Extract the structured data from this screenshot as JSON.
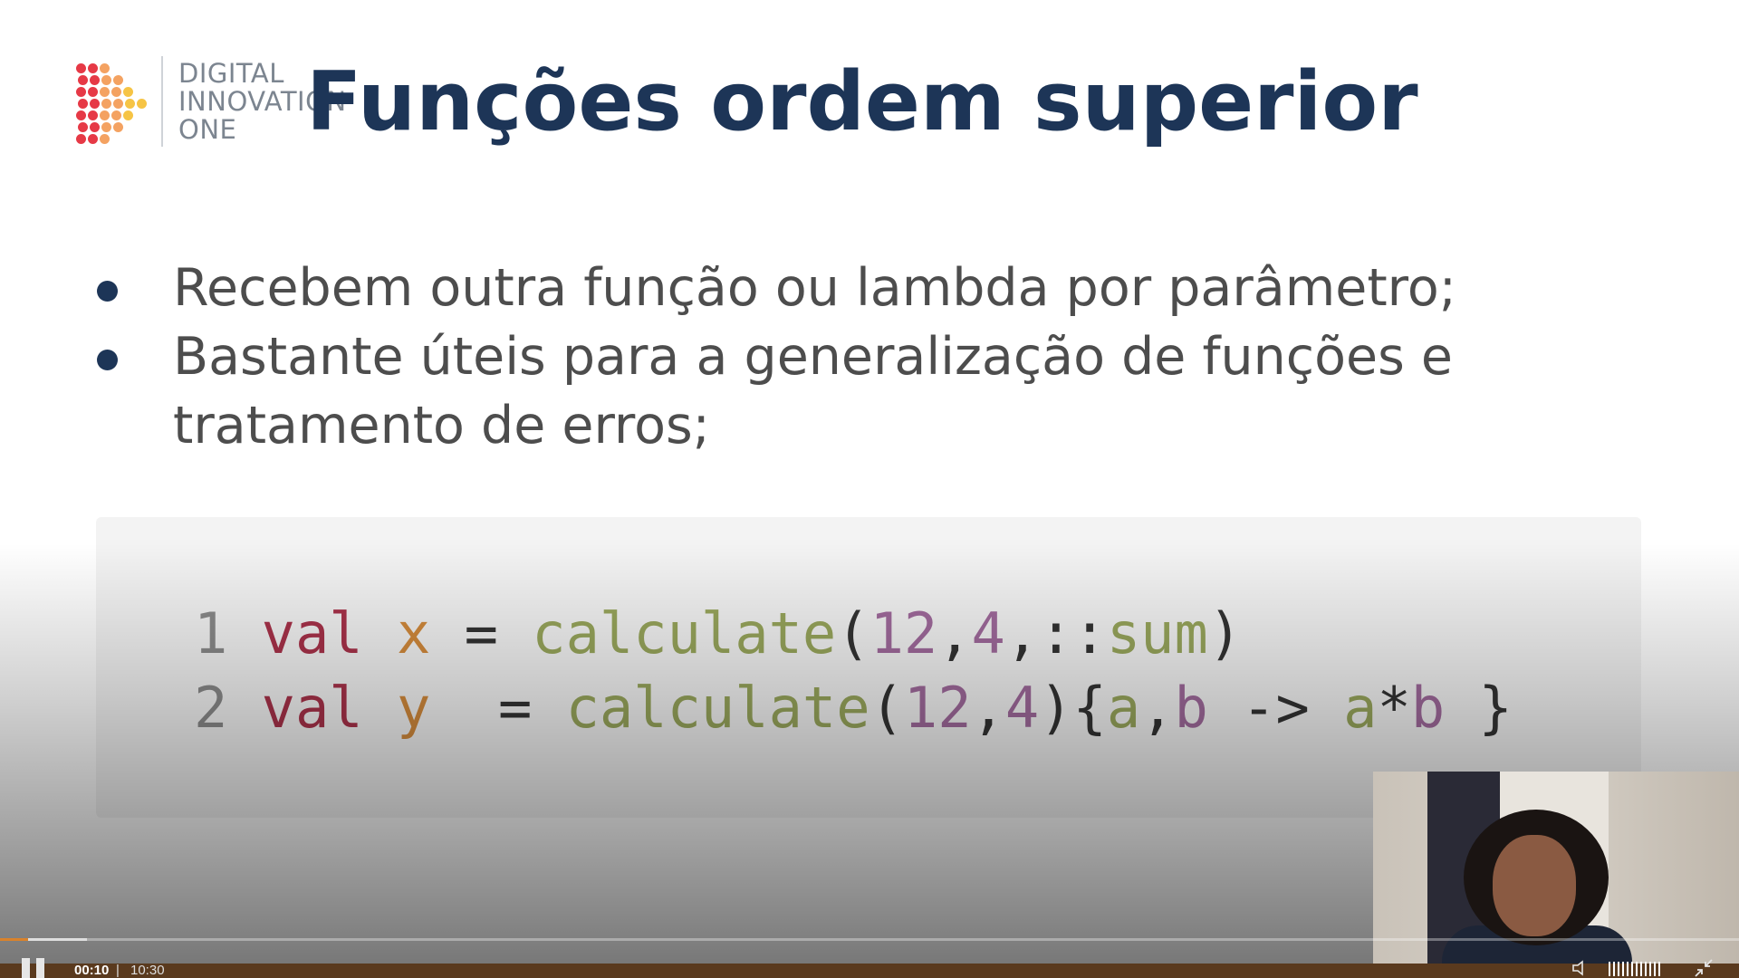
{
  "slide": {
    "logo": {
      "lines": [
        "DIGITAL",
        "INNOVATION",
        "ONE"
      ],
      "icon": "dio-logo-icon",
      "colors": [
        "#e63946",
        "#f4a261",
        "#f6c445"
      ]
    },
    "title": "Funções ordem superior",
    "bullets": [
      "Recebem outra função ou lambda por parâmetro;",
      "Bastante úteis para a generalização de funções e tratamento de erros;"
    ],
    "code": {
      "lines": [
        {
          "number": "1",
          "tokens": [
            {
              "text": "val",
              "type": "kw"
            },
            {
              "text": " ",
              "type": "pun"
            },
            {
              "text": "x",
              "type": "id"
            },
            {
              "text": " = ",
              "type": "pun"
            },
            {
              "text": "calculate",
              "type": "fn"
            },
            {
              "text": "(",
              "type": "pun"
            },
            {
              "text": "12",
              "type": "num"
            },
            {
              "text": ",",
              "type": "pun"
            },
            {
              "text": "4",
              "type": "num"
            },
            {
              "text": ",::",
              "type": "pun"
            },
            {
              "text": "sum",
              "type": "fn"
            },
            {
              "text": ")",
              "type": "pun"
            }
          ]
        },
        {
          "number": "2",
          "tokens": [
            {
              "text": "val",
              "type": "kw"
            },
            {
              "text": " ",
              "type": "pun"
            },
            {
              "text": "y",
              "type": "id"
            },
            {
              "text": "  = ",
              "type": "pun"
            },
            {
              "text": "calculate",
              "type": "fn"
            },
            {
              "text": "(",
              "type": "pun"
            },
            {
              "text": "12",
              "type": "num"
            },
            {
              "text": ",",
              "type": "pun"
            },
            {
              "text": "4",
              "type": "num"
            },
            {
              "text": "){",
              "type": "pun"
            },
            {
              "text": "a",
              "type": "fn"
            },
            {
              "text": ",",
              "type": "pun"
            },
            {
              "text": "b",
              "type": "num"
            },
            {
              "text": " -> ",
              "type": "pun"
            },
            {
              "text": "a",
              "type": "fn"
            },
            {
              "text": "*",
              "type": "pun"
            },
            {
              "text": "b",
              "type": "num"
            },
            {
              "text": " }",
              "type": "pun"
            }
          ]
        }
      ]
    }
  },
  "player": {
    "current_time": "00:10",
    "separator": "|",
    "total_time": "10:30",
    "progress": 0.016,
    "accent_color": "#d9822b",
    "icons": {
      "play_pause": "pause-icon",
      "volume": "speaker-icon",
      "fullscreen": "exit-fullscreen-icon"
    }
  }
}
